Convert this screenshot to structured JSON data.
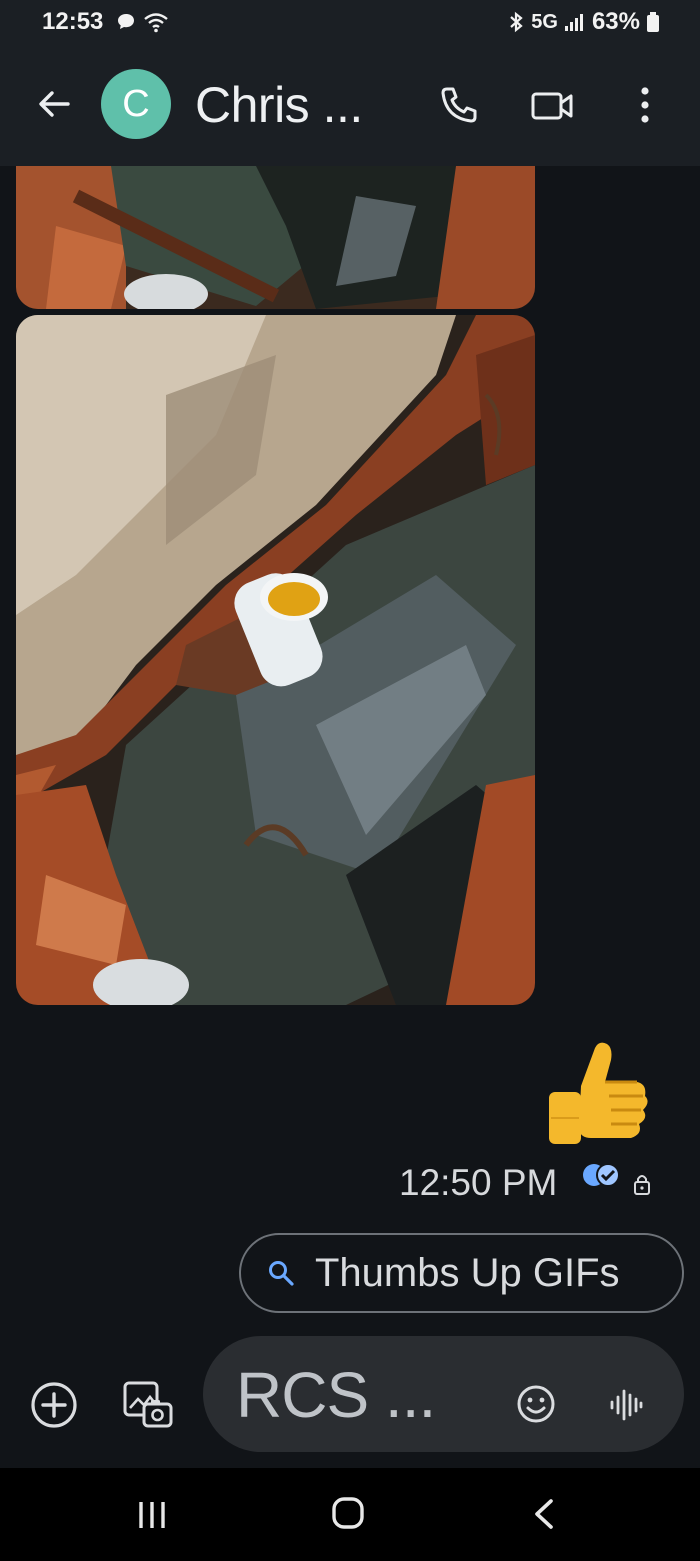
{
  "status_bar": {
    "time": "12:53",
    "network": "5G",
    "battery": "63%"
  },
  "header": {
    "avatar_initial": "C",
    "contact_name": "Chris ..."
  },
  "messages": [
    {
      "type": "image",
      "sender": "contact"
    },
    {
      "type": "image",
      "sender": "contact"
    },
    {
      "type": "emoji",
      "sender": "me",
      "emoji": "thumbs-up",
      "time": "12:50 PM",
      "status": "read"
    }
  ],
  "suggestion_chip": {
    "label": "Thumbs Up GIFs"
  },
  "composer": {
    "placeholder": "RCS ..."
  },
  "colors": {
    "accent_avatar": "#5fc0aa",
    "read_receipt": "#6aa8ff",
    "background": "#111418"
  }
}
